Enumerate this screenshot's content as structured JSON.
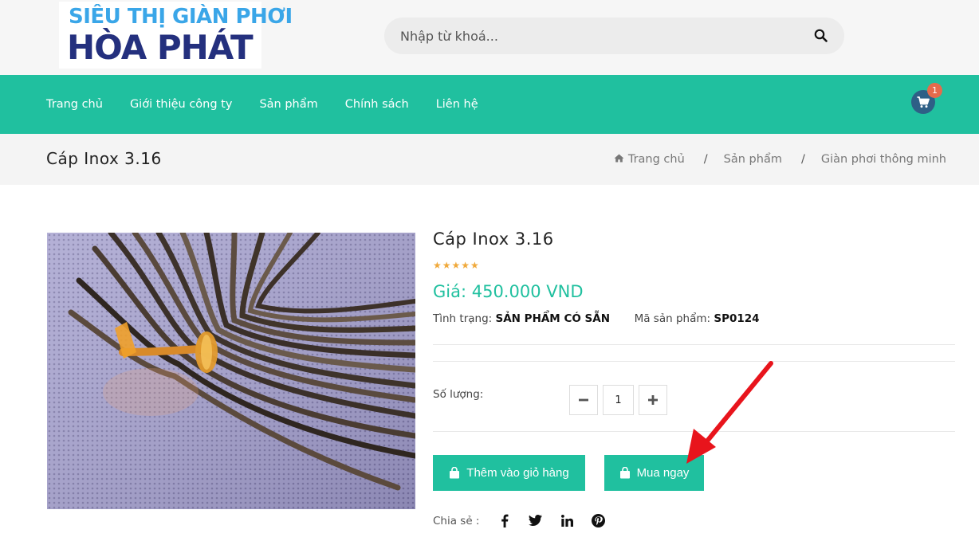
{
  "header": {
    "logo_line1": "SIÊU THỊ GIÀN PHƠI",
    "logo_line2": "HÒA PHÁT",
    "search_placeholder": "Nhập từ khoá..."
  },
  "nav": {
    "items": [
      "Trang chủ",
      "Giới thiệu công ty",
      "Sản phẩm",
      "Chính sách",
      "Liên hệ"
    ],
    "cart_count": "1"
  },
  "breadcrumb": {
    "page_title": "Cáp Inox 3.16",
    "items": [
      "Trang chủ",
      "Sản phẩm",
      "Giàn phơi thông minh"
    ],
    "separator": "/"
  },
  "product": {
    "name": "Cáp Inox 3.16",
    "rating": "★★★★★",
    "price": "Giá: 450.000 VND",
    "status_label": "Tình trạng:",
    "status_value": "SẢN PHẨM CÓ SẴN",
    "sku_label": "Mã sản phẩm:",
    "sku_value": "SP0124",
    "qty_label": "Số lượng:",
    "qty_value": "1",
    "add_to_cart_label": "Thêm vào giỏ hàng",
    "buy_now_label": "Mua ngay",
    "share_label": "Chia sẻ :",
    "share_icons": [
      "facebook-icon",
      "twitter-icon",
      "linkedin-icon",
      "pinterest-icon"
    ]
  },
  "colors": {
    "accent": "#20c09f",
    "cart_bg": "#2e5f86",
    "cart_badge": "#e56a4c",
    "stars": "#f0a93b",
    "annotation_arrow": "#e8141c"
  }
}
